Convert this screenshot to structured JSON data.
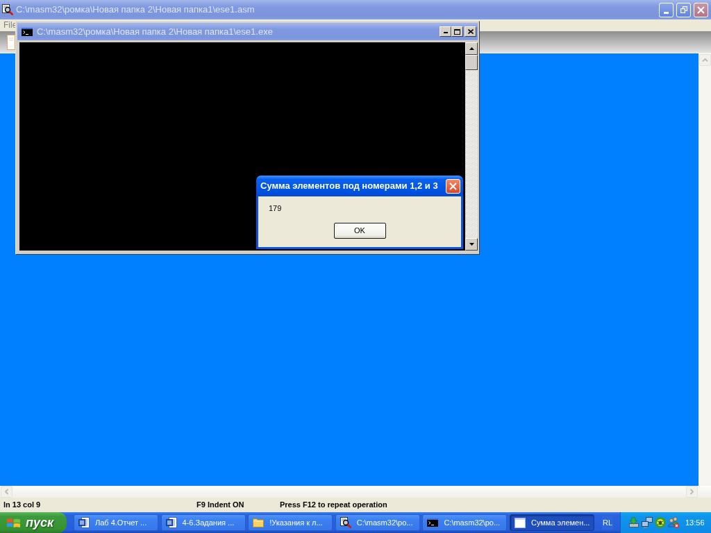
{
  "main_window": {
    "title": "C:\\masm32\\ромка\\Новая папка 2\\Новая папка1\\ese1.asm",
    "active": false,
    "menu": [
      "File"
    ],
    "status_bar": [
      "ln 13 col 9",
      "F9 Indent ON",
      "Press F12 to repeat operation"
    ]
  },
  "console_window": {
    "title": "C:\\masm32\\ромка\\Новая папка 2\\Новая папка1\\ese1.exe",
    "active": false
  },
  "message_box": {
    "title": "Сумма элементов под номерами 1,2 и 3",
    "active": true,
    "message": "179",
    "buttons": [
      "OK"
    ]
  },
  "taskbar": {
    "start": "пуск",
    "tasks": [
      {
        "label": "Лаб 4.Отчет ...",
        "kind": "document",
        "selected": false
      },
      {
        "label": "4-6.Задания ...",
        "kind": "document",
        "selected": false
      },
      {
        "label": "!Указания к л...",
        "kind": "folder",
        "selected": false
      },
      {
        "label": "C:\\masm32\\ро...",
        "kind": "assembler",
        "selected": false
      },
      {
        "label": "C:\\masm32\\ро...",
        "kind": "console",
        "selected": false
      },
      {
        "label": "Сумма элемен...",
        "kind": "window",
        "selected": true
      }
    ],
    "language": "RL",
    "clock": "13:56"
  }
}
